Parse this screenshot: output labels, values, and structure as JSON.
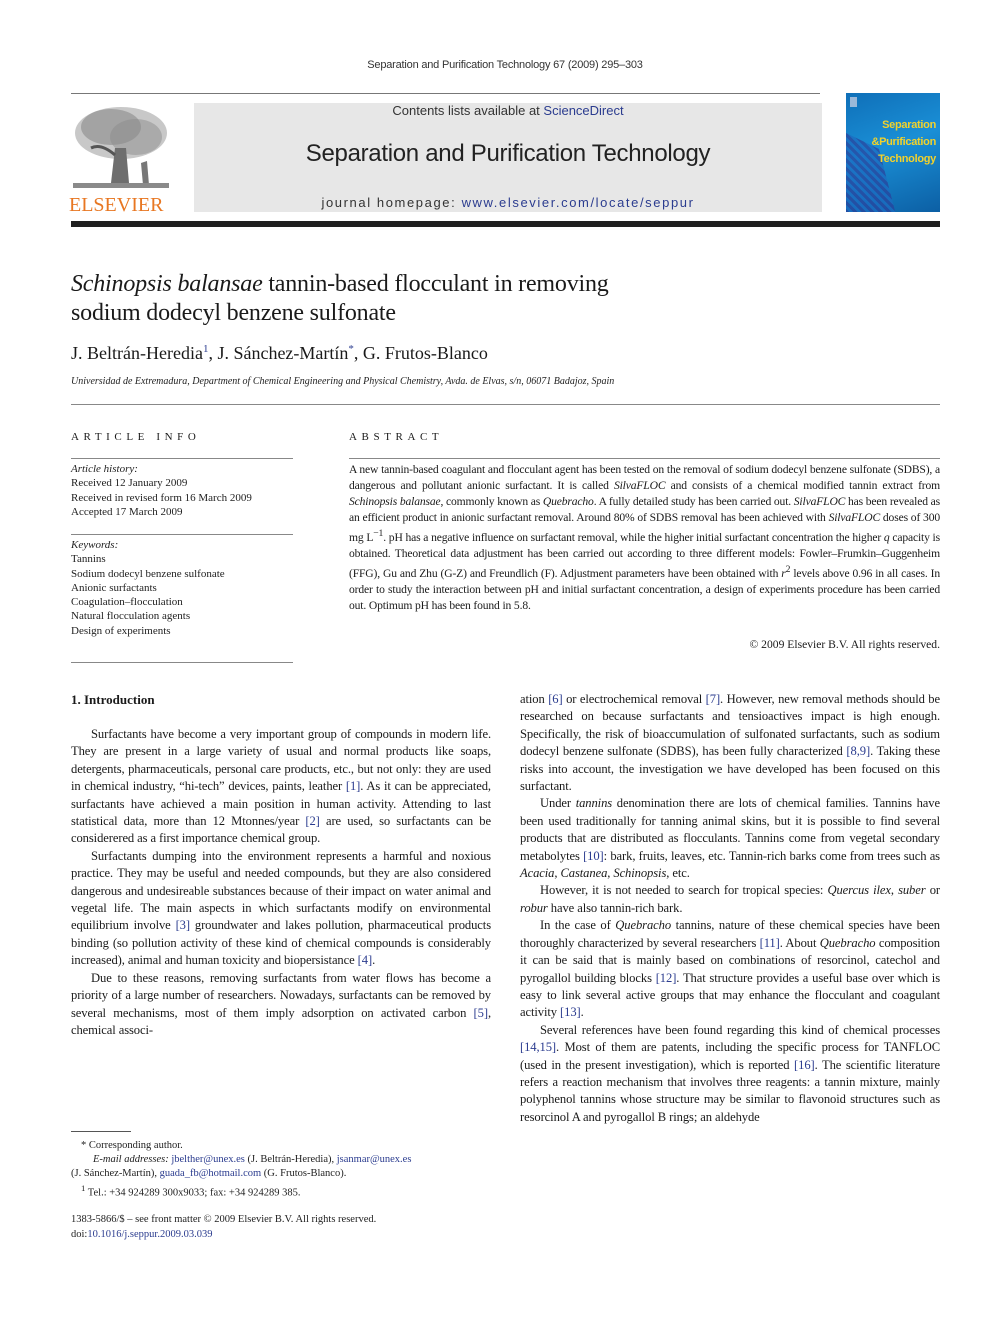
{
  "running_head": "Separation and Purification Technology 67 (2009) 295–303",
  "masthead": {
    "publisher_logo_text": "ELSEVIER",
    "contents_prefix": "Contents lists available at ",
    "contents_link": "ScienceDirect",
    "journal_title": "Separation and Purification Technology",
    "homepage_prefix": "journal homepage: ",
    "homepage_link": "www.elsevier.com/locate/seppur",
    "cover": {
      "line1": "Separation",
      "line2": "&Purification",
      "line3": "Technology"
    },
    "colors": {
      "elsevier_orange": "#e87722",
      "link_blue": "#2b3c8f",
      "cover_blue": "#1a8fd6",
      "cover_title_yellow": "#f2d22c"
    }
  },
  "article": {
    "title_italic": "Schinopsis balansae",
    "title_rest_line1": " tannin-based flocculant in removing",
    "title_line2": "sodium dodecyl benzene sulfonate",
    "authors": [
      {
        "name": "J. Beltrán-Heredia",
        "mark": "1"
      },
      {
        "name": "J. Sánchez-Martín",
        "mark": "*"
      },
      {
        "name": "G. Frutos-Blanco",
        "mark": ""
      }
    ],
    "affiliation": "Universidad de Extremadura, Department of Chemical Engineering and Physical Chemistry, Avda. de Elvas, s/n, 06071 Badajoz, Spain"
  },
  "article_info": {
    "heading": "ARTICLE INFO",
    "history_label": "Article history:",
    "history": [
      "Received 12 January 2009",
      "Received in revised form 16 March 2009",
      "Accepted 17 March 2009"
    ],
    "keywords_label": "Keywords:",
    "keywords": [
      "Tannins",
      "Sodium dodecyl benzene sulfonate",
      "Anionic surfactants",
      "Coagulation–flocculation",
      "Natural flocculation agents",
      "Design of experiments"
    ]
  },
  "abstract": {
    "heading": "ABSTRACT",
    "s1": "A new tannin-based coagulant and flocculant agent has been tested on the removal of sodium dodecyl benzene sulfonate (SDBS), a dangerous and pollutant anionic surfactant. It is called ",
    "silvafloc": "SilvaFLOC",
    "s2": " and consists of a chemical modified tannin extract from ",
    "schinopsis": "Schinopsis balansae",
    "s3": ", commonly known as ",
    "quebracho": "Quebracho",
    "s4": ". A fully detailed study has been carried out. ",
    "s5": " has been revealed as an efficient product in anionic surfactant removal. Around 80% of SDBS removal has been achieved with ",
    "s6": " doses of 300 mg L",
    "s6_sup": "−1",
    "s7": ". pH has a negative influence on surfactant removal, while the higher initial surfactant concentration the higher ",
    "q": "q",
    "s8": " capacity is obtained. Theoretical data adjustment has been carried out according to three different models: Fowler–Frumkin–Guggenheim (FFG), Gu and Zhu (G-Z) and Freundlich (F). Adjustment parameters have been obtained with ",
    "r": "r",
    "r_sup": "2",
    "s9": " levels above 0.96 in all cases. In order to study the interaction between pH and initial surfactant concentration, a design of experiments procedure has been carried out. Optimum pH has been found in 5.8.",
    "copyright": "© 2009 Elsevier B.V. All rights reserved."
  },
  "introduction": {
    "heading": "1.  Introduction",
    "p1a": "Surfactants have become a very important group of compounds in modern life. They are present in a large variety of usual and normal products like soaps, detergents, pharmaceuticals, personal care products, etc., but not only: they are used in chemical industry, “hi-tech” devices, paints, leather ",
    "ref1": "[1]",
    "p1b": ". As it can be appreciated, surfactants have achieved a main position in human activity. Attending to last statistical data, more than 12 Mtonnes/year ",
    "ref2": "[2]",
    "p1c": " are used, so surfactants can be considerered as a first importance chemical group.",
    "p2a": "Surfactants dumping into the environment represents a harmful and noxious practice. They may be useful and needed compounds, but they are also considered dangerous and undesireable substances because of their impact on water animal and vegetal life. The main aspects in which surfactants modify on environmental equilibrium involve ",
    "ref3": "[3]",
    "p2b": " groundwater and lakes pollution, pharmaceutical products binding (so pollution activity of these kind of chemical compounds is considerably increased), animal and human toxicity and biopersistance ",
    "ref4": "[4]",
    "p2c": ".",
    "p3a": "Due to these reasons, removing surfactants from water flows has become a priority of a large number of researchers. Nowadays, surfactants can be removed by several mechanisms, most of them imply adsorption on activated carbon ",
    "ref5": "[5]",
    "p3b": ", chemical associ-",
    "r1a": "ation ",
    "ref6": "[6]",
    "r1b": " or electrochemical removal ",
    "ref7": "[7]",
    "r1c": ". However, new removal methods should be researched on because surfactants and tensioactives impact is high enough. Specifically, the risk of bioaccumulation of sulfonated surfactants, such as sodium dodecyl benzene sulfonate (SDBS), has been fully characterized ",
    "ref89": "[8,9]",
    "r1d": ". Taking these risks into account, the investigation we have developed has been focused on this surfactant.",
    "p4a": "Under ",
    "p4_tannins": "tannins",
    "p4b": " denomination there are lots of chemical families. Tannins have been used traditionally for tanning animal skins, but it is possible to find several products that are distributed as flocculants. Tannins come from vegetal secondary metabolytes ",
    "ref10": "[10]",
    "p4c": ": bark, fruits, leaves, etc. Tannin-rich barks come from trees such as ",
    "p4_acacia": "Acacia",
    "p4_sep1": ", ",
    "p4_castanea": "Castanea",
    "p4_sep2": ", ",
    "p4_schinopsis": "Schinopsis",
    "p4d": ", etc.",
    "p5a": "However, it is not needed to search for tropical species: ",
    "p5_quercus": "Quercus ilex",
    "p5_sep1": ", ",
    "p5_suber": "suber",
    "p5_or": " or ",
    "p5_robur": "robur",
    "p5b": " have also tannin-rich bark.",
    "p6a": "In the case of ",
    "p6_quebracho": "Quebracho",
    "p6b": " tannins, nature of these chemical species have been thoroughly characterized by several researchers ",
    "ref11": "[11]",
    "p6c": ". About ",
    "p6_quebracho2": "Quebracho",
    "p6d": " composition it can be said that is mainly based on combinations of resorcinol, catechol and pyrogallol building blocks ",
    "ref12": "[12]",
    "p6e": ". That structure provides a useful base over which is easy to link several active groups that may enhance the flocculant and coagulant activity ",
    "ref13": "[13]",
    "p6f": ".",
    "p7a": "Several references have been found regarding this kind of chemical processes ",
    "ref1415": "[14,15]",
    "p7b": ". Most of them are patents, including the specific process for TANFLOC (used in the present investigation), which is reported ",
    "ref16": "[16]",
    "p7c": ". The scientific literature refers a reaction mechanism that involves three reagents: a tannin mixture, mainly polyphenol tannins whose structure may be similar to flavonoid structures such as resorcinol A and pyrogallol B rings; an aldehyde"
  },
  "footnotes": {
    "corresponding": "*   Corresponding author.",
    "email_label": "E-mail addresses:",
    "email1": "jbelther@unex.es",
    "email1_who": " (J. Beltrán-Heredia), ",
    "email2": "jsanmar@unex.es",
    "email2_who": "(J. Sánchez-Martín), ",
    "email3": "guada_fb@hotmail.com",
    "email3_who": " (G. Frutos-Blanco).",
    "tel_mark": "1",
    "tel": " Tel.: +34 924289 300x9033; fax: +34 924289 385."
  },
  "front_matter": {
    "issn_line": "1383-5866/$ – see front matter © 2009 Elsevier B.V. All rights reserved.",
    "doi_prefix": "doi:",
    "doi": "10.1016/j.seppur.2009.03.039"
  }
}
